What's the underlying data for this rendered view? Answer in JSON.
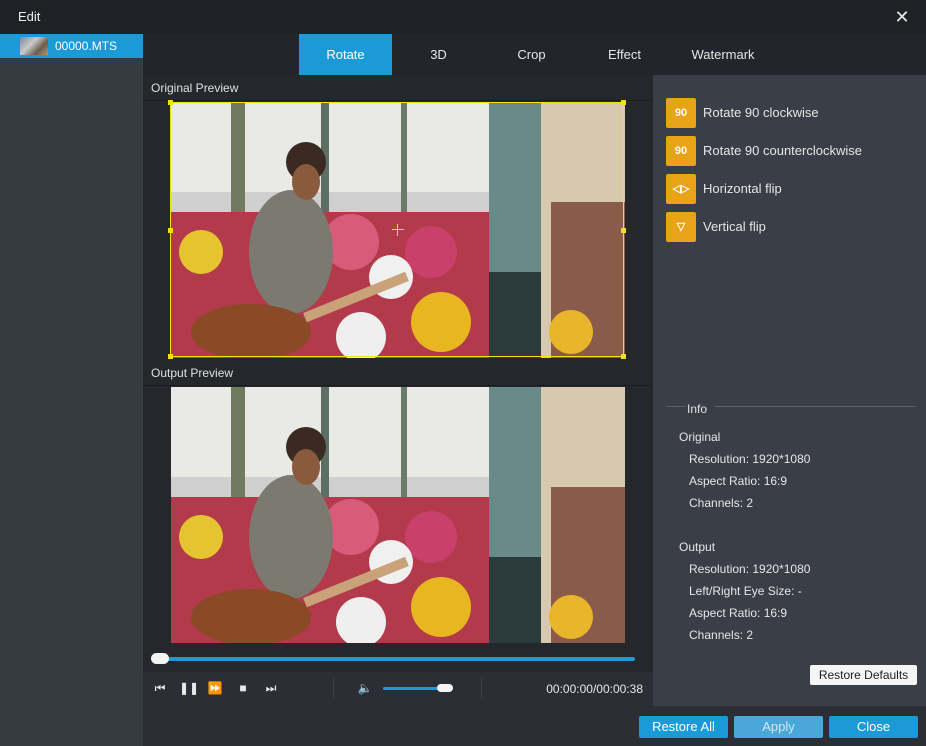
{
  "window": {
    "title": "Edit"
  },
  "files": [
    {
      "name": "00000.MTS"
    }
  ],
  "tabs": [
    {
      "label": "Rotate",
      "active": true
    },
    {
      "label": "3D"
    },
    {
      "label": "Crop"
    },
    {
      "label": "Effect"
    },
    {
      "label": "Watermark"
    }
  ],
  "preview": {
    "original_label": "Original Preview",
    "output_label": "Output Preview"
  },
  "player": {
    "timecode": "00:00:00/00:00:38",
    "progress": 0.0,
    "volume": 0.8
  },
  "rotate_actions": [
    {
      "icon": "rotate-cw-icon",
      "glyph": "90",
      "label": "Rotate 90 clockwise"
    },
    {
      "icon": "rotate-ccw-icon",
      "glyph": "90",
      "label": "Rotate 90 counterclockwise"
    },
    {
      "icon": "flip-horizontal-icon",
      "glyph": "◁▷",
      "label": "Horizontal flip"
    },
    {
      "icon": "flip-vertical-icon",
      "glyph": "▽",
      "label": "Vertical flip"
    }
  ],
  "info": {
    "title": "Info",
    "original": {
      "heading": "Original",
      "resolution": "Resolution: 1920*1080",
      "aspect_ratio": "Aspect Ratio: 16:9",
      "channels": "Channels: 2"
    },
    "output": {
      "heading": "Output",
      "resolution": "Resolution: 1920*1080",
      "eye_size": "Left/Right Eye Size: -",
      "aspect_ratio": "Aspect Ratio: 16:9",
      "channels": "Channels: 2"
    }
  },
  "buttons": {
    "restore_defaults": "Restore Defaults",
    "restore_all": "Restore All",
    "apply": "Apply",
    "close": "Close"
  },
  "colors": {
    "accent": "#1a9ad6",
    "action_icon": "#e8a317",
    "crop_frame": "#f2e20a"
  }
}
